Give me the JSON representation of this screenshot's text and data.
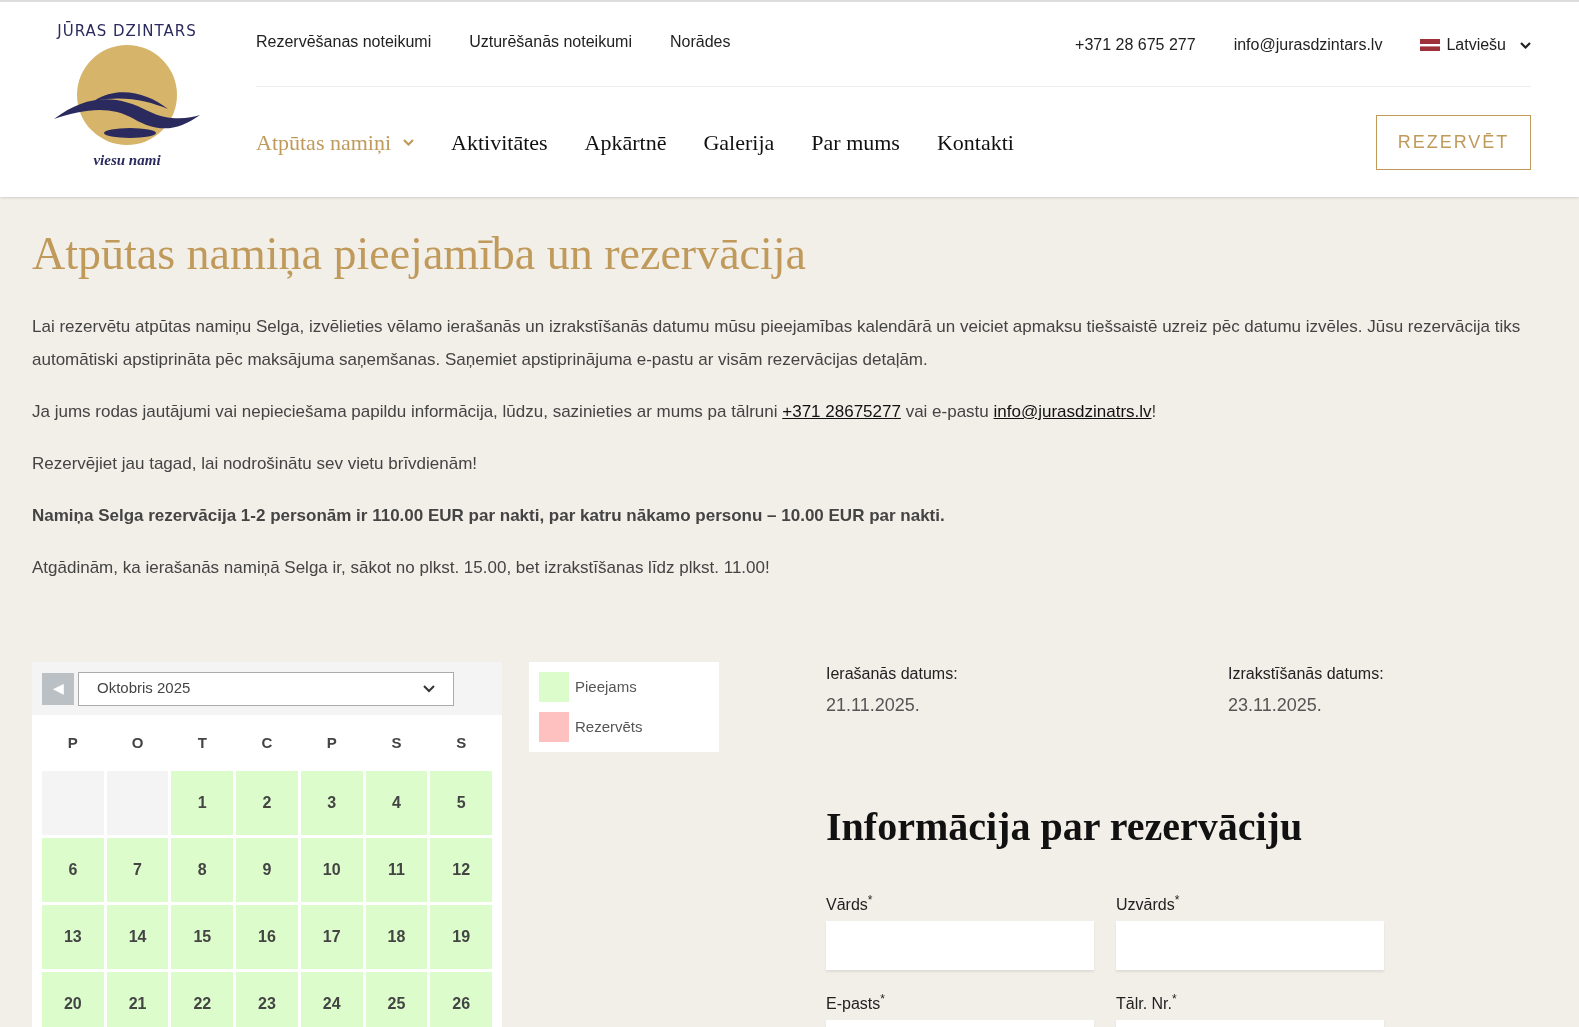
{
  "logo": {
    "title": "JŪRAS DZINTARS",
    "subtitle": "viesu nami"
  },
  "top_links": [
    "Rezervēšanas noteikumi",
    "Uzturēšanās noteikumi",
    "Norādes"
  ],
  "contact": {
    "phone": "+371 28 675 277",
    "email": "info@jurasdzintars.lv",
    "language": "Latviešu"
  },
  "nav": [
    {
      "label": "Atpūtas namiņi",
      "selected": true,
      "dropdown": true
    },
    {
      "label": "Aktivitātes",
      "selected": false,
      "dropdown": false
    },
    {
      "label": "Apkārtnē",
      "selected": false,
      "dropdown": false
    },
    {
      "label": "Galerija",
      "selected": false,
      "dropdown": false
    },
    {
      "label": "Par mums",
      "selected": false,
      "dropdown": false
    },
    {
      "label": "Kontakti",
      "selected": false,
      "dropdown": false
    }
  ],
  "reserve_button": "REZERVĒT",
  "page_title": "Atpūtas namiņa pieejamība un rezervācija",
  "paragraphs": [
    {
      "kind": "plain",
      "parts": [
        {
          "kind": "text",
          "text": "Lai rezervētu atpūtas namiņu Selga, izvēlieties vēlamo ierašanās un izrakstīšanās datumu mūsu pieejamības kalendārā un veiciet apmaksu tiešsaistē uzreiz pēc datumu izvēles. Jūsu rezervācija tiks automātiski apstiprināta pēc maksājuma saņemšanas. Saņemiet apstiprinājuma e-pastu ar visām rezervācijas detaļām."
        }
      ]
    },
    {
      "kind": "plain",
      "parts": [
        {
          "kind": "text",
          "text": "Ja jums rodas jautājumi vai nepieciešama papildu informācija, lūdzu, sazinieties ar mums pa tālruni "
        },
        {
          "kind": "link",
          "text": "+371 28675277"
        },
        {
          "kind": "text",
          "text": " vai e-pastu "
        },
        {
          "kind": "link",
          "text": "info@jurasdzinatrs.lv"
        },
        {
          "kind": "text",
          "text": "!"
        }
      ]
    },
    {
      "kind": "plain",
      "parts": [
        {
          "kind": "text",
          "text": "Rezervējiet jau tagad, lai nodrošinātu sev vietu brīvdienām!"
        }
      ]
    },
    {
      "kind": "bold",
      "parts": [
        {
          "kind": "text",
          "text": "Namiņa Selga rezervācija 1-2 personām ir 110.00 EUR par nakti, par katru nākamo personu – 10.00 EUR par nakti."
        }
      ]
    },
    {
      "kind": "plain",
      "parts": [
        {
          "kind": "text",
          "text": "Atgādinām, ka ierašanās namiņā Selga ir, sākot no plkst. 15.00, bet izrakstīšanas līdz plkst. 11.00!"
        }
      ]
    }
  ],
  "calendar": {
    "prev": "◀",
    "month": "Oktobris 2025",
    "weekdays": [
      "P",
      "O",
      "T",
      "C",
      "P",
      "S",
      "S"
    ],
    "weeks": [
      [
        {
          "kind": "empty"
        },
        {
          "kind": "empty"
        },
        {
          "kind": "available",
          "day": "1"
        },
        {
          "kind": "available",
          "day": "2"
        },
        {
          "kind": "available",
          "day": "3"
        },
        {
          "kind": "available",
          "day": "4"
        },
        {
          "kind": "available",
          "day": "5"
        }
      ],
      [
        {
          "kind": "available",
          "day": "6"
        },
        {
          "kind": "available",
          "day": "7"
        },
        {
          "kind": "available",
          "day": "8"
        },
        {
          "kind": "available",
          "day": "9"
        },
        {
          "kind": "available",
          "day": "10"
        },
        {
          "kind": "available",
          "day": "11"
        },
        {
          "kind": "available",
          "day": "12"
        }
      ],
      [
        {
          "kind": "available",
          "day": "13"
        },
        {
          "kind": "available",
          "day": "14"
        },
        {
          "kind": "available",
          "day": "15"
        },
        {
          "kind": "available",
          "day": "16"
        },
        {
          "kind": "available",
          "day": "17"
        },
        {
          "kind": "available",
          "day": "18"
        },
        {
          "kind": "available",
          "day": "19"
        }
      ],
      [
        {
          "kind": "available",
          "day": "20"
        },
        {
          "kind": "available",
          "day": "21"
        },
        {
          "kind": "available",
          "day": "22"
        },
        {
          "kind": "available",
          "day": "23"
        },
        {
          "kind": "available",
          "day": "24"
        },
        {
          "kind": "available",
          "day": "25"
        },
        {
          "kind": "available",
          "day": "26"
        }
      ]
    ]
  },
  "legend": [
    {
      "label": "Pieejams",
      "color": "#dcfccb"
    },
    {
      "label": "Rezervēts",
      "color": "#ffc0c0"
    }
  ],
  "dates": [
    {
      "label": "Ierašanās datums:",
      "value": "21.11.2025."
    },
    {
      "label": "Izrakstīšanās datums:",
      "value": "23.11.2025."
    }
  ],
  "form": {
    "title": "Informācija par rezervāciju",
    "fields": [
      {
        "label": "Vārds"
      },
      {
        "label": "Uzvārds"
      },
      {
        "label": "E-pasts"
      },
      {
        "label": "Tālr. Nr."
      }
    ],
    "required_mark": "*"
  }
}
